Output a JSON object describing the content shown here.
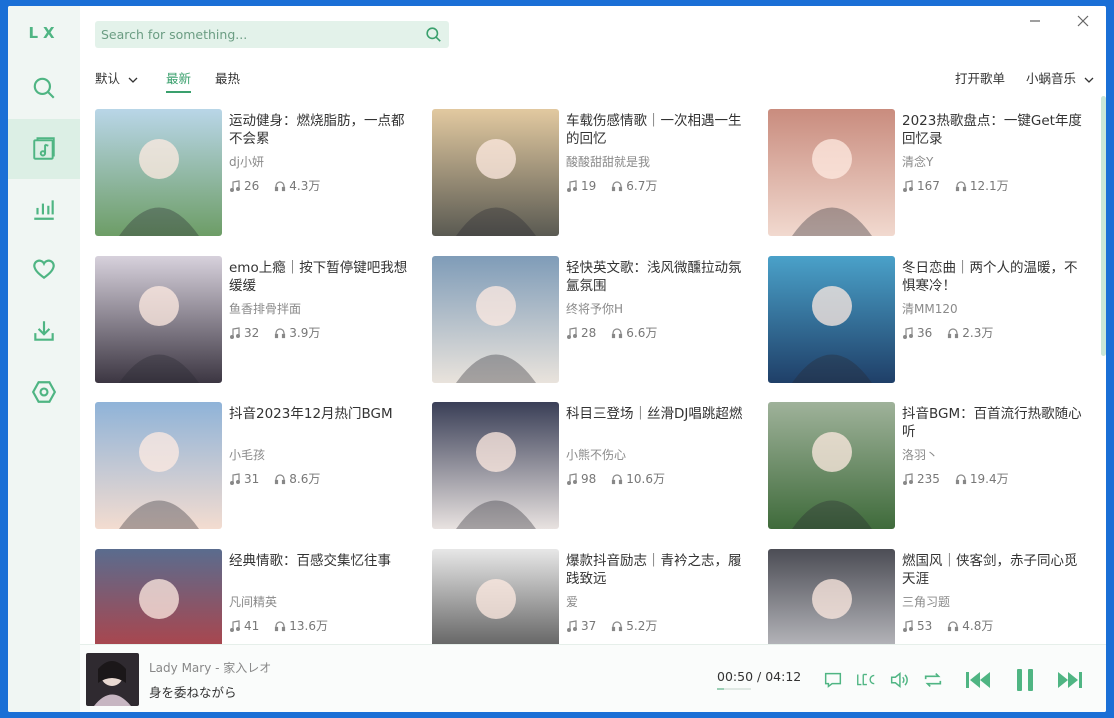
{
  "app": {
    "logo": "LX"
  },
  "colors": {
    "accent": "#3aa06d",
    "sidebar_bg": "#f0f6f3",
    "search_bg": "#e3f2ea"
  },
  "sidebar": {
    "items": [
      {
        "icon": "search-icon"
      },
      {
        "icon": "music-note-icon",
        "active": true
      },
      {
        "icon": "bar-chart-icon"
      },
      {
        "icon": "heart-icon"
      },
      {
        "icon": "download-icon"
      },
      {
        "icon": "settings-icon"
      }
    ]
  },
  "search": {
    "placeholder": "Search for something..."
  },
  "filters": {
    "sort": "默认",
    "tab_new": "最新",
    "tab_hot": "最热"
  },
  "actions": {
    "open_playlist": "打开歌单",
    "source": "小蜗音乐"
  },
  "playlists": [
    {
      "title": "运动健身：燃烧脂肪，一点都不会累",
      "author": "dj小妍",
      "songs": "26",
      "plays": "4.3万",
      "palette": [
        "#b9d6e8",
        "#6d9d66"
      ]
    },
    {
      "title": "车载伤感情歌｜一次相遇一生的回忆",
      "author": "酸酸甜甜就是我",
      "songs": "19",
      "plays": "6.7万",
      "palette": [
        "#e2c9a0",
        "#5a5a52"
      ]
    },
    {
      "title": "2023热歌盘点：一键Get年度回忆录",
      "author": "清念Y",
      "songs": "167",
      "plays": "12.1万",
      "palette": [
        "#c98c7e",
        "#f1d9cf"
      ]
    },
    {
      "title": "emo上瘾｜按下暂停键吧我想缓缓",
      "author": "鱼香排骨拌面",
      "songs": "32",
      "plays": "3.9万",
      "palette": [
        "#d7d1dc",
        "#3c3642"
      ]
    },
    {
      "title": "轻快英文歌：浅风微醺拉动氛氲氛围",
      "author": "终将予你H",
      "songs": "28",
      "plays": "6.6万",
      "palette": [
        "#7f9cb8",
        "#e9e3dc"
      ]
    },
    {
      "title": "冬日恋曲｜两个人的温暖，不惧寒冷！",
      "author": "清MM120",
      "songs": "36",
      "plays": "2.3万",
      "palette": [
        "#4aa1c9",
        "#1f3f68"
      ]
    },
    {
      "title": "抖音2023年12月热门BGM",
      "author": "小毛孩",
      "songs": "31",
      "plays": "8.6万",
      "palette": [
        "#8fb3d8",
        "#f3dcd0"
      ]
    },
    {
      "title": "科目三登场｜丝滑DJ唱跳超燃",
      "author": "小熊不伤心",
      "songs": "98",
      "plays": "10.6万",
      "palette": [
        "#3a3f57",
        "#e8e2e0"
      ]
    },
    {
      "title": "抖音BGM：百首流行热歌随心听",
      "author": "洛羽丶",
      "songs": "235",
      "plays": "19.4万",
      "palette": [
        "#9fb29a",
        "#3f6b3b"
      ]
    },
    {
      "title": "经典情歌：百感交集忆往事",
      "author": "凡间精英",
      "songs": "41",
      "plays": "13.6万",
      "palette": [
        "#5a6c8e",
        "#c23a3a"
      ]
    },
    {
      "title": "爆款抖音励志｜青衿之志，履践致远",
      "author": "爱",
      "songs": "37",
      "plays": "5.2万",
      "palette": [
        "#e7e7e7",
        "#3d3d3d"
      ]
    },
    {
      "title": "燃国风｜侠客剑，赤子同心觅天涯",
      "author": "三角习题",
      "songs": "53",
      "plays": "4.8万",
      "palette": [
        "#4c4d55",
        "#d4d4d8"
      ]
    }
  ],
  "player": {
    "artist_line": "Lady Mary - 家入レオ",
    "lyric": "身を委ねながら",
    "current_time": "00:50",
    "separator": "/",
    "total_time": "04:12",
    "progress": 0.2
  }
}
